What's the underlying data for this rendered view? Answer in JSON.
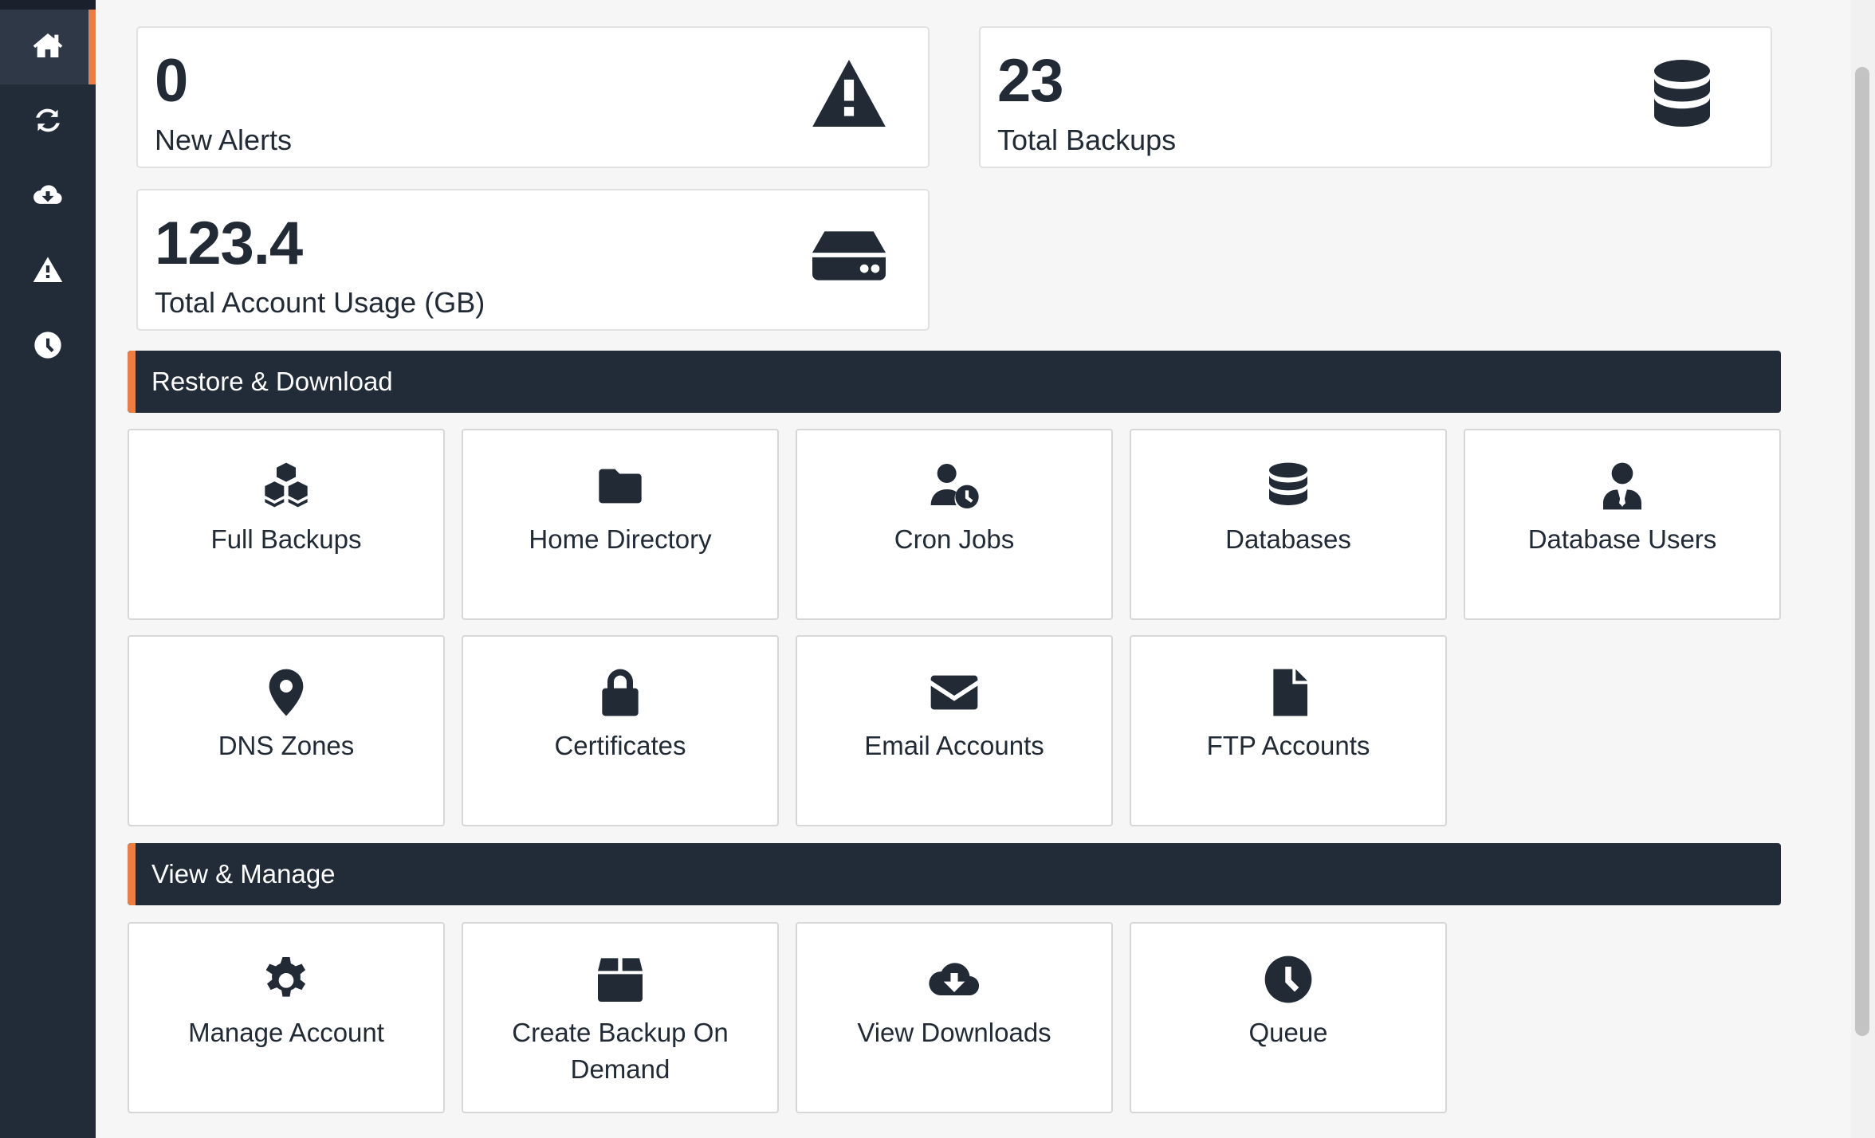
{
  "sidebar": {
    "items": [
      {
        "icon": "home-icon",
        "active": true
      },
      {
        "icon": "refresh-icon",
        "active": false
      },
      {
        "icon": "cloud-download-icon",
        "active": false
      },
      {
        "icon": "warning-icon",
        "active": false
      },
      {
        "icon": "clock-icon",
        "active": false
      }
    ]
  },
  "stats": {
    "alerts": {
      "value": "0",
      "label": "New Alerts",
      "icon": "warning-icon"
    },
    "backups": {
      "value": "23",
      "label": "Total Backups",
      "icon": "database-icon"
    },
    "usage": {
      "value": "123.4",
      "label": "Total Account Usage (GB)",
      "icon": "hard-drive-icon"
    }
  },
  "restore": {
    "title": "Restore & Download",
    "tiles": [
      {
        "label": "Full Backups",
        "icon": "cubes-icon"
      },
      {
        "label": "Home Directory",
        "icon": "folder-icon"
      },
      {
        "label": "Cron Jobs",
        "icon": "user-clock-icon"
      },
      {
        "label": "Databases",
        "icon": "database-icon"
      },
      {
        "label": "Database Users",
        "icon": "user-tie-icon"
      },
      {
        "label": "DNS Zones",
        "icon": "map-marker-icon"
      },
      {
        "label": "Certificates",
        "icon": "lock-icon"
      },
      {
        "label": "Email Accounts",
        "icon": "envelope-icon"
      },
      {
        "label": "FTP Accounts",
        "icon": "file-icon"
      }
    ]
  },
  "manage": {
    "title": "View & Manage",
    "tiles": [
      {
        "label": "Manage Account",
        "icon": "gear-icon"
      },
      {
        "label": "Create Backup On Demand",
        "icon": "box-icon"
      },
      {
        "label": "View Downloads",
        "icon": "cloud-download-icon"
      },
      {
        "label": "Queue",
        "icon": "clock-icon"
      }
    ]
  },
  "colors": {
    "accent": "#f07d3f",
    "dark": "#222b38",
    "text": "#212a35"
  }
}
